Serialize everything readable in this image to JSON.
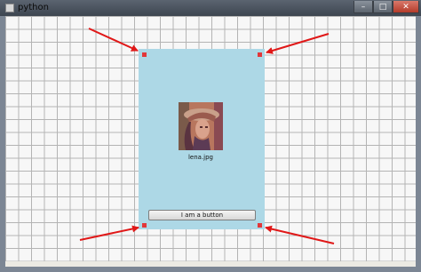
{
  "window": {
    "title": "python",
    "minimize_glyph": "–",
    "maximize_glyph": "□",
    "close_glyph": "✕"
  },
  "panel": {
    "image_caption": "lena.jpg",
    "button_label": "I am a button",
    "background_color": "#add8e6"
  },
  "annotations": {
    "arrow_color": "#e01818",
    "handle_color": "#e2373a"
  }
}
